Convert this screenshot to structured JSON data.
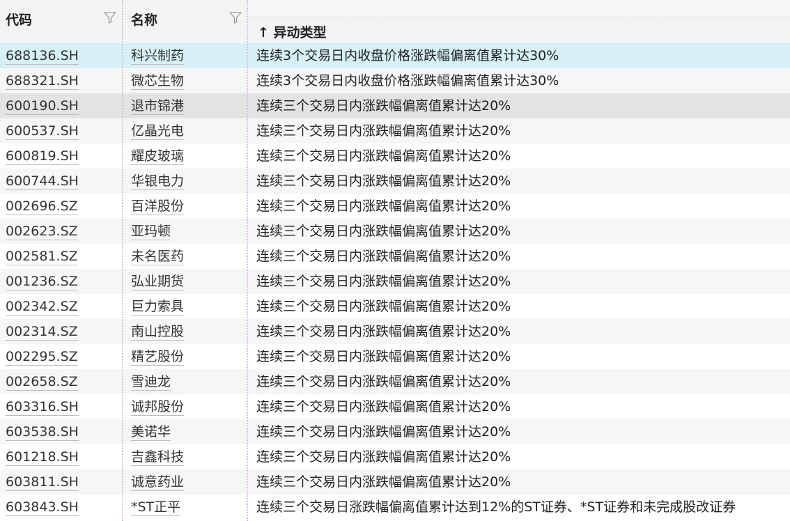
{
  "header": {
    "code_label": "代码",
    "name_label": "名称",
    "type_label": "↑ 异动类型"
  },
  "colors": {
    "header_bg": "#f3f3f3",
    "row_selected": "#d6f0f6",
    "row_hover": "#e3e3e3",
    "row_alt": "#f5f6f6",
    "row_plain": "#ffffff",
    "separator": "#d6bde0"
  },
  "rows": [
    {
      "code": "688136.SH",
      "name": "科兴制药",
      "type": "连续3个交易日内收盘价格涨跌幅偏离值累计达30%",
      "state": "selected"
    },
    {
      "code": "688321.SH",
      "name": "微芯生物",
      "type": "连续3个交易日内收盘价格涨跌幅偏离值累计达30%",
      "state": "alt"
    },
    {
      "code": "600190.SH",
      "name": "退市锦港",
      "type": "连续三个交易日内涨跌幅偏离值累计达20%",
      "state": "hover"
    },
    {
      "code": "600537.SH",
      "name": "亿晶光电",
      "type": "连续三个交易日内涨跌幅偏离值累计达20%",
      "state": "alt"
    },
    {
      "code": "600819.SH",
      "name": "耀皮玻璃",
      "type": "连续三个交易日内涨跌幅偏离值累计达20%",
      "state": "plain"
    },
    {
      "code": "600744.SH",
      "name": "华银电力",
      "type": "连续三个交易日内涨跌幅偏离值累计达20%",
      "state": "alt"
    },
    {
      "code": "002696.SZ",
      "name": "百洋股份",
      "type": "连续三个交易日内涨跌幅偏离值累计达20%",
      "state": "plain"
    },
    {
      "code": "002623.SZ",
      "name": "亚玛顿",
      "type": "连续三个交易日内涨跌幅偏离值累计达20%",
      "state": "alt"
    },
    {
      "code": "002581.SZ",
      "name": "未名医药",
      "type": "连续三个交易日内涨跌幅偏离值累计达20%",
      "state": "plain"
    },
    {
      "code": "001236.SZ",
      "name": "弘业期货",
      "type": "连续三个交易日内涨跌幅偏离值累计达20%",
      "state": "alt"
    },
    {
      "code": "002342.SZ",
      "name": "巨力索具",
      "type": "连续三个交易日内涨跌幅偏离值累计达20%",
      "state": "plain"
    },
    {
      "code": "002314.SZ",
      "name": "南山控股",
      "type": "连续三个交易日内涨跌幅偏离值累计达20%",
      "state": "alt"
    },
    {
      "code": "002295.SZ",
      "name": "精艺股份",
      "type": "连续三个交易日内涨跌幅偏离值累计达20%",
      "state": "plain"
    },
    {
      "code": "002658.SZ",
      "name": "雪迪龙",
      "type": "连续三个交易日内涨跌幅偏离值累计达20%",
      "state": "alt"
    },
    {
      "code": "603316.SH",
      "name": "诚邦股份",
      "type": "连续三个交易日内涨跌幅偏离值累计达20%",
      "state": "plain"
    },
    {
      "code": "603538.SH",
      "name": "美诺华",
      "type": "连续三个交易日内涨跌幅偏离值累计达20%",
      "state": "alt"
    },
    {
      "code": "601218.SH",
      "name": "吉鑫科技",
      "type": "连续三个交易日内涨跌幅偏离值累计达20%",
      "state": "plain"
    },
    {
      "code": "603811.SH",
      "name": "诚意药业",
      "type": "连续三个交易日内涨跌幅偏离值累计达20%",
      "state": "alt"
    },
    {
      "code": "603843.SH",
      "name": "*ST正平",
      "type": "连续三个交易日涨跌幅偏离值累计达到12%的ST证券、*ST证券和未完成股改证券",
      "state": "plain"
    }
  ]
}
